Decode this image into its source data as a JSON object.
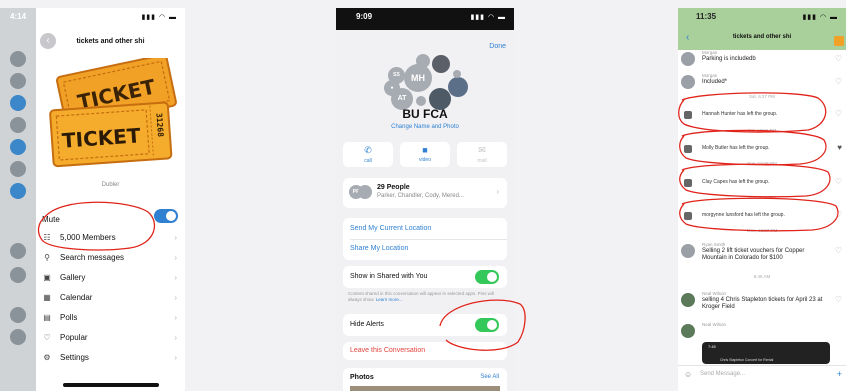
{
  "colors": {
    "accent_blue": "#2f80d1",
    "toggle_green": "#34c759",
    "annotation_red": "#e0241b",
    "destructive_red": "#e0443d"
  },
  "phone1": {
    "time": "4:14",
    "title": "tickets and other shi",
    "ticket_text_top": "TICKET",
    "ticket_text_main": "TICKET",
    "ticket_serial": "31268",
    "caption": "Dubler",
    "mute_label": "Mute",
    "mute_on": true,
    "menu": [
      {
        "label": "5,000 Members",
        "icon": "members-icon"
      },
      {
        "label": "Search messages",
        "icon": "search-icon"
      },
      {
        "label": "Gallery",
        "icon": "gallery-icon"
      },
      {
        "label": "Calendar",
        "icon": "calendar-icon"
      },
      {
        "label": "Polls",
        "icon": "polls-icon"
      },
      {
        "label": "Popular",
        "icon": "heart-icon"
      },
      {
        "label": "Settings",
        "icon": "gear-icon"
      }
    ]
  },
  "phone2": {
    "time": "9:09",
    "done_label": "Done",
    "avatars": {
      "mh": "MH",
      "at": "AT",
      "ss": "SS"
    },
    "group_name": "BU FCA",
    "change_name_label": "Change Name and Photo",
    "actions": [
      {
        "glyph": "✆",
        "label": "call",
        "enabled": true
      },
      {
        "glyph": "■",
        "label": "video",
        "enabled": true
      },
      {
        "glyph": "✉",
        "label": "mail",
        "enabled": false
      }
    ],
    "people_badge": "PF",
    "people_title": "29 People",
    "people_subtitle": "Parker, Chandler, Cody, Mered...",
    "send_location": "Send My Current Location",
    "share_location": "Share My Location",
    "show_shared_label": "Show in Shared with You",
    "show_shared_on": true,
    "show_shared_note": "Content shared in this conversation will appear in selected apps. Pins will always show.",
    "learn_more": "Learn more...",
    "hide_alerts_label": "Hide Alerts",
    "hide_alerts_on": true,
    "leave_label": "Leave this Conversation",
    "photos_label": "Photos",
    "see_all_label": "See All"
  },
  "phone3": {
    "time": "11:35",
    "title": "tickets and other shi",
    "messages_top": [
      {
        "name": "Morgan",
        "text": "Parking is includedb"
      },
      {
        "name": "Morgan",
        "text": "Included*"
      }
    ],
    "system": [
      {
        "time": "Sat, 6:27 PM",
        "text": "Hannah Hunter has left the group."
      },
      {
        "time": "Sat, 10:56 PM",
        "text": "Molly Butler has left the group."
      },
      {
        "time": "Sun, 12:15 PM",
        "text": "Clay Capes has left the group."
      },
      {
        "time": "Sun, 2:42 PM",
        "text": "morgynne lunsford has left the group."
      }
    ],
    "after_time": "Mon, 12:07 PM",
    "messages_bottom": [
      {
        "name": "Ryan Smith",
        "text": "Selling 2 lift ticket vouchers for Copper Mountain in Colorado for $100"
      },
      {
        "name": "Neal Wilson",
        "text": "selling 4 Chris Stapleton tickets for April 23 at Kroger Field"
      },
      {
        "name": "Neal Wilson",
        "text": ""
      }
    ],
    "mid_time": "8:45 AM",
    "thumb_time": "7:45",
    "thumb_caption": "Chris Stapleton Concert for Rental",
    "input_placeholder": "Send Message..."
  }
}
